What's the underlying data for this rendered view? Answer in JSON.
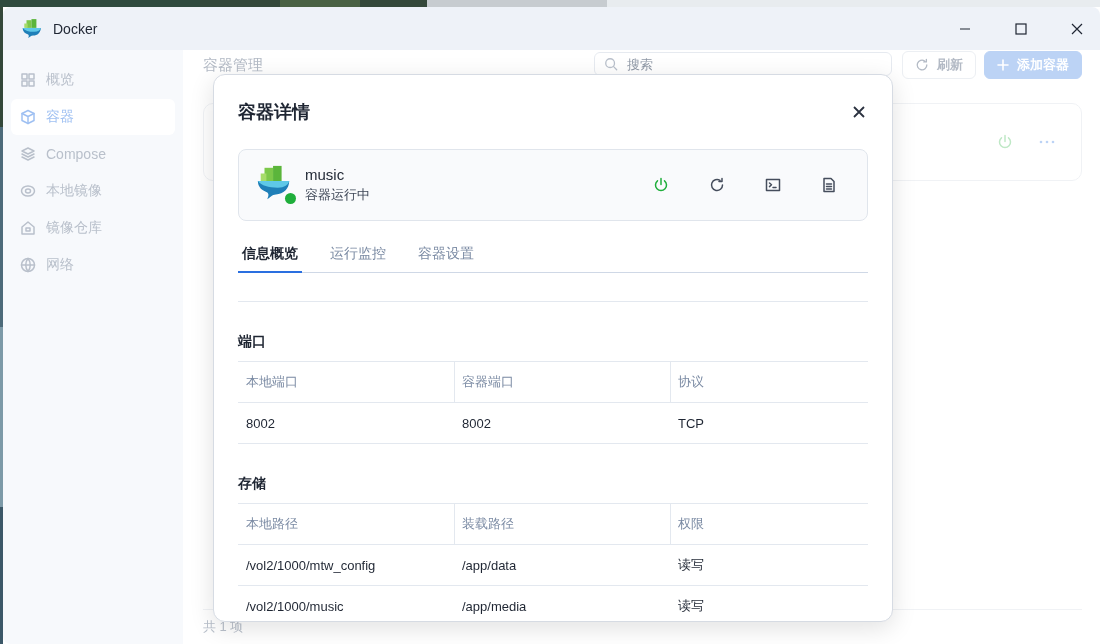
{
  "window": {
    "title": "Docker"
  },
  "sidebar": {
    "items": [
      {
        "label": "概览",
        "selected": false
      },
      {
        "label": "容器",
        "selected": true
      },
      {
        "label": "Compose",
        "selected": false
      },
      {
        "label": "本地镜像",
        "selected": false
      },
      {
        "label": "镜像仓库",
        "selected": false
      },
      {
        "label": "网络",
        "selected": false
      }
    ]
  },
  "page": {
    "title": "容器管理",
    "search": {
      "placeholder": "搜索"
    },
    "buttons": [
      {
        "label": "刷新",
        "kind": "refresh"
      },
      {
        "label": "添加容器",
        "kind": "add"
      }
    ],
    "footer": "共 1 项"
  },
  "dialog": {
    "title": "容器详情",
    "container": {
      "name": "music",
      "status": "容器运行中",
      "running": true
    },
    "tabs": [
      {
        "label": "信息概览",
        "selected": true
      },
      {
        "label": "运行监控",
        "selected": false
      },
      {
        "label": "容器设置",
        "selected": false
      }
    ],
    "sections": [
      {
        "title": "端口",
        "columns": [
          "本地端口",
          "容器端口",
          "协议"
        ],
        "rows": [
          [
            "8002",
            "8002",
            "TCP"
          ]
        ]
      },
      {
        "title": "存储",
        "columns": [
          "本地路径",
          "装载路径",
          "权限"
        ],
        "rows": [
          [
            "/vol2/1000/mtw_config",
            "/app/data",
            "读写"
          ],
          [
            "/vol2/1000/music",
            "/app/media",
            "读写"
          ]
        ]
      }
    ]
  }
}
